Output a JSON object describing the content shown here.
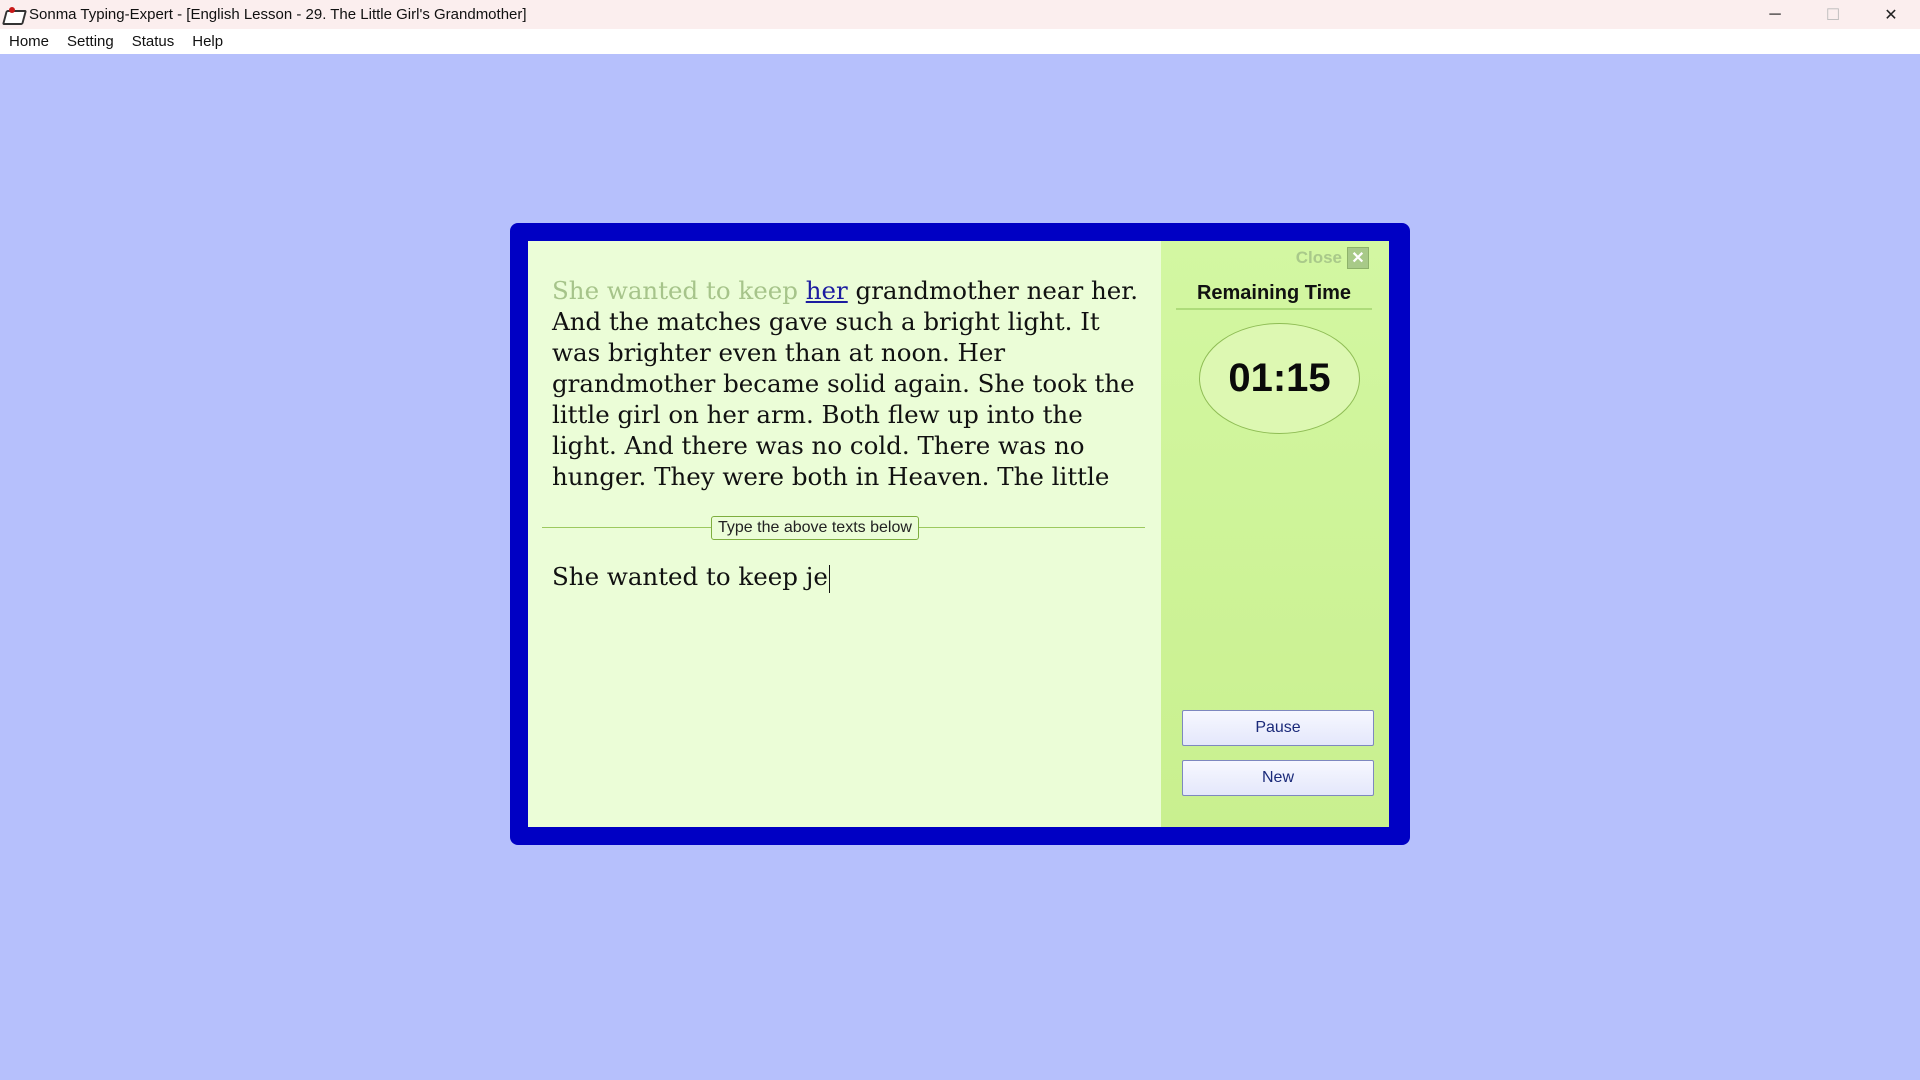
{
  "window": {
    "title": "Sonma Typing-Expert - [English Lesson - 29. The Little Girl's Grandmother]",
    "controls": {
      "minimize": "─",
      "maximize": "☐",
      "close": "✕"
    }
  },
  "menu": [
    "Home",
    "Setting",
    "Status",
    "Help"
  ],
  "lesson": {
    "typed_part": "She wanted to keep ",
    "current_word": "her",
    "remaining_text": " grandmother near her. And the matches gave such a bright light. It was brighter even than at noon. Her grandmother became solid again. She took the little girl on her arm. Both flew up into the light. And there was no cold. There was no hunger. They were both in Heaven. The little",
    "divider_label": "Type the above texts below",
    "typed_input": "She wanted to keep je"
  },
  "side_panel": {
    "close_label": "Close",
    "close_icon": "✕",
    "remaining_time_label": "Remaining Time",
    "timer": "01:15",
    "pause_label": "Pause",
    "new_label": "New"
  },
  "colors": {
    "background": "#b6c0fc",
    "frame": "#0000c4",
    "content": "#ebfdd7",
    "panel": "#cff39a",
    "typed_text": "#a6c48a"
  }
}
